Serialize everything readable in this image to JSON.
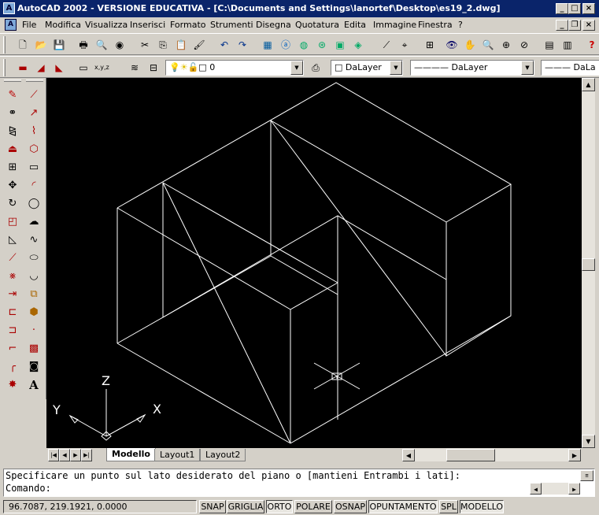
{
  "window": {
    "title": "AutoCAD 2002 - VERSIONE EDUCATIVA - [C:\\Documents and Settings\\lanortef\\Desktop\\es19_2.dwg]",
    "app_icon": "autocad-icon",
    "minimize": "_",
    "maximize": "□",
    "close": "×"
  },
  "menu": {
    "items": [
      "File",
      "Modifica",
      "Visualizza",
      "Inserisci",
      "Formato",
      "Strumenti",
      "Disegna",
      "Quotatura",
      "Edita",
      "Immagine",
      "Finestra",
      "?"
    ]
  },
  "properties_toolbar": {
    "layer_value": "0",
    "color_value": "DaLayer",
    "linetype_value": "DaLayer",
    "lineweight_value": "DaLa"
  },
  "layout_tabs": [
    "Modello",
    "Layout1",
    "Layout2"
  ],
  "ucs": {
    "x": "X",
    "y": "Y",
    "z": "Z"
  },
  "command": {
    "history_line": "Specificare un punto sul lato desiderato del piano o [mantieni Entrambi i lati]:",
    "prompt": "Comando:"
  },
  "status": {
    "coordinates": "96.7087,  219.1921, 0.0000",
    "toggles": [
      {
        "label": "SNAP",
        "on": false
      },
      {
        "label": "GRIGLIA",
        "on": false
      },
      {
        "label": "ORTO",
        "on": true
      },
      {
        "label": "POLARE",
        "on": false
      },
      {
        "label": "OSNAP",
        "on": false
      },
      {
        "label": "OPUNTAMENTO",
        "on": true
      },
      {
        "label": "SPL",
        "on": false
      },
      {
        "label": "MODELLO",
        "on": true
      }
    ]
  },
  "colors": {
    "titlebar": "#0a246a",
    "chrome": "#d4d0c8",
    "drawing_background": "#000000",
    "wireframe": "#ffffff"
  }
}
